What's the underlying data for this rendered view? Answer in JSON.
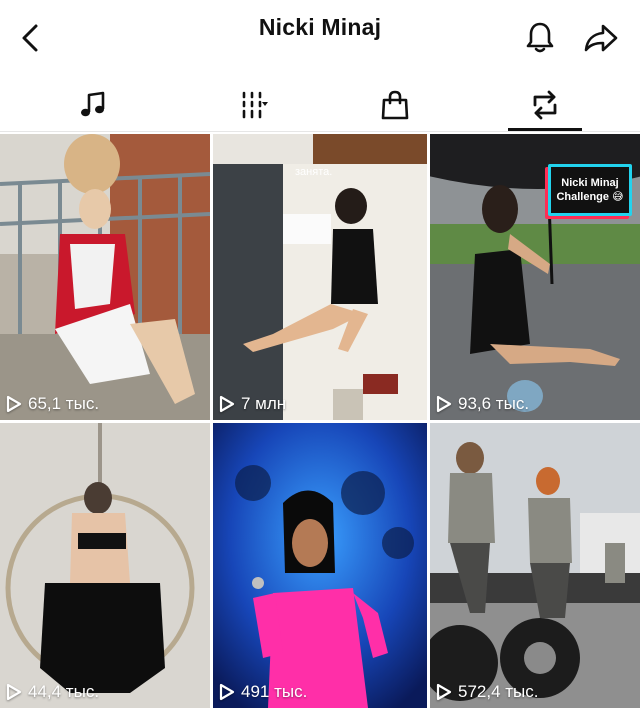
{
  "header": {
    "title": "Nicki Minaj"
  },
  "tabs": [
    {
      "name": "music-note-icon",
      "active": false
    },
    {
      "name": "playlists-dropdown-icon",
      "active": false
    },
    {
      "name": "shopping-bag-icon",
      "active": false
    },
    {
      "name": "repost-icon",
      "active": true
    }
  ],
  "videos": [
    {
      "views": "65,1 тыс.",
      "overlay": ""
    },
    {
      "views": "7 млн",
      "overlay": "занята."
    },
    {
      "views": "93,6 тыс.",
      "overlay": "Nicki Minaj Challenge 😅"
    },
    {
      "views": "44,4 тыс.",
      "overlay": ""
    },
    {
      "views": "491 тыс.",
      "overlay": ""
    },
    {
      "views": "572,4 тыс.",
      "overlay": ""
    }
  ],
  "colors": {
    "accent_cyan": "#22d3ee",
    "accent_pink": "#ff2d55",
    "text": "#111111"
  }
}
